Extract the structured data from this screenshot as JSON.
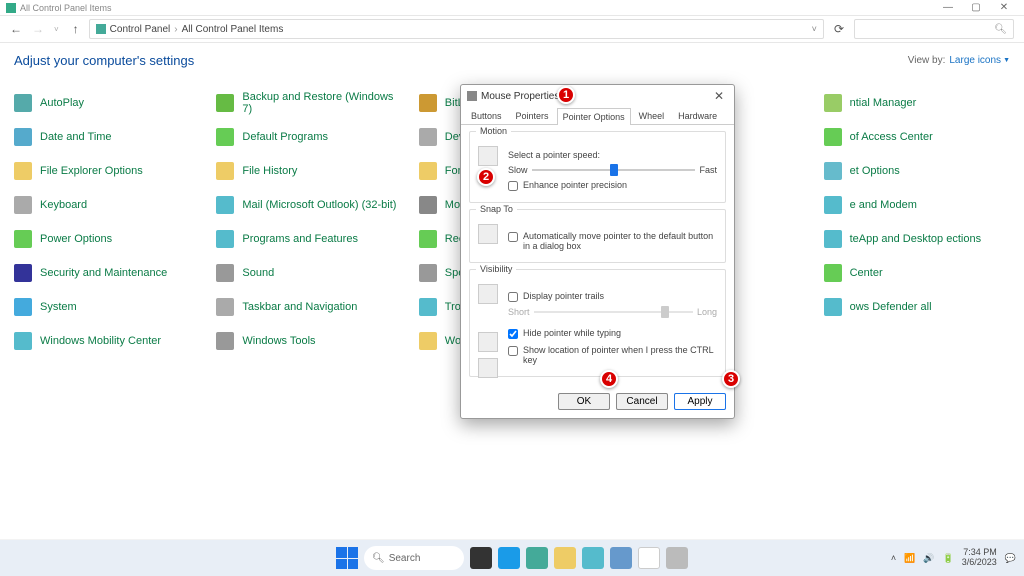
{
  "titlebar": {
    "text": "All Control Panel Items"
  },
  "nav": {
    "addr_icon": "■",
    "crumb1": "Control Panel",
    "crumb2": "All Control Panel Items"
  },
  "header": {
    "title": "Adjust your computer's settings",
    "viewby": "View by:",
    "viewsel": "Large icons"
  },
  "items": [
    {
      "label": "AutoPlay",
      "c": "#5aa"
    },
    {
      "label": "Backup and Restore (Windows 7)",
      "c": "#6b4"
    },
    {
      "label": "BitLocker Drive E",
      "c": "#c93"
    },
    {
      "label": " ",
      "c": "#fff"
    },
    {
      "label": "ntial Manager",
      "c": "#9c6"
    },
    {
      "label": "Date and Time",
      "c": "#5ac"
    },
    {
      "label": "Default Programs",
      "c": "#6c5"
    },
    {
      "label": "Device Manager",
      "c": "#aaa"
    },
    {
      "label": " ",
      "c": "#fff"
    },
    {
      "label": "of Access Center",
      "c": "#6c5"
    },
    {
      "label": "File Explorer Options",
      "c": "#ec6"
    },
    {
      "label": "File History",
      "c": "#ec6"
    },
    {
      "label": "Fonts",
      "c": "#ec6"
    },
    {
      "label": " ",
      "c": "#fff"
    },
    {
      "label": "et Options",
      "c": "#6bc"
    },
    {
      "label": "Keyboard",
      "c": "#aaa"
    },
    {
      "label": "Mail (Microsoft Outlook) (32-bit)",
      "c": "#5bc"
    },
    {
      "label": "Mouse",
      "c": "#888"
    },
    {
      "label": " ",
      "c": "#fff"
    },
    {
      "label": "e and Modem",
      "c": "#5bc"
    },
    {
      "label": "Power Options",
      "c": "#6c5"
    },
    {
      "label": "Programs and Features",
      "c": "#5bc"
    },
    {
      "label": "Recovery",
      "c": "#6c5"
    },
    {
      "label": " ",
      "c": "#fff"
    },
    {
      "label": "teApp and Desktop ections",
      "c": "#5bc"
    },
    {
      "label": "Security and Maintenance",
      "c": "#339"
    },
    {
      "label": "Sound",
      "c": "#999"
    },
    {
      "label": "Speech Recogniti",
      "c": "#999"
    },
    {
      "label": " ",
      "c": "#fff"
    },
    {
      "label": "Center",
      "c": "#6c5"
    },
    {
      "label": "System",
      "c": "#4ad"
    },
    {
      "label": "Taskbar and Navigation",
      "c": "#aaa"
    },
    {
      "label": "Troubleshooting",
      "c": "#5bc"
    },
    {
      "label": " ",
      "c": "#fff"
    },
    {
      "label": "ows Defender all",
      "c": "#5bc"
    },
    {
      "label": "Windows Mobility Center",
      "c": "#5bc"
    },
    {
      "label": "Windows Tools",
      "c": "#999"
    },
    {
      "label": "Work Folders",
      "c": "#ec6"
    }
  ],
  "dialog": {
    "title": "Mouse Properties",
    "tabs": [
      "Buttons",
      "Pointers",
      "Pointer Options",
      "Wheel",
      "Hardware"
    ],
    "motion": {
      "title": "Motion",
      "select": "Select a pointer speed:",
      "slow": "Slow",
      "fast": "Fast",
      "enhance": "Enhance pointer precision"
    },
    "snap": {
      "title": "Snap To",
      "auto": "Automatically move pointer to the default button in a dialog box"
    },
    "vis": {
      "title": "Visibility",
      "trails": "Display pointer trails",
      "short": "Short",
      "long": "Long",
      "hide": "Hide pointer while typing",
      "ctrl": "Show location of pointer when I press the CTRL key"
    },
    "ok": "OK",
    "cancel": "Cancel",
    "apply": "Apply"
  },
  "taskbar": {
    "search": "Search",
    "time": "7:34 PM",
    "date": "3/6/2023"
  }
}
